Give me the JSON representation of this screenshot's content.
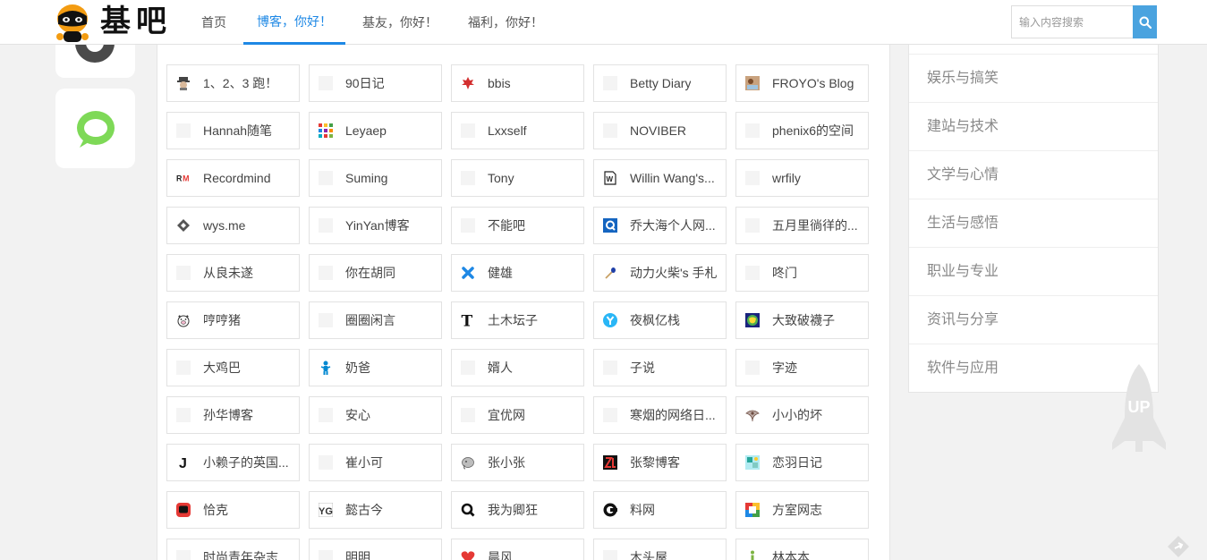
{
  "header": {
    "logo_text": "基吧",
    "nav": [
      {
        "label": "首页",
        "active": false
      },
      {
        "label": "博客，你好！",
        "active": true
      },
      {
        "label": "基友，你好！",
        "active": false
      },
      {
        "label": "福利，你好！",
        "active": false
      }
    ],
    "search": {
      "placeholder": "输入内容搜索",
      "icon": "search-icon"
    }
  },
  "colors": {
    "accent": "#1e88e5",
    "search_button": "#4aa3df",
    "chat_icon": "#7ed957"
  },
  "links": [
    {
      "label": "1、2、3 跑！",
      "icon": "avatar"
    },
    {
      "label": "90日记",
      "icon": "blank"
    },
    {
      "label": "bbis",
      "icon": "maple-leaf"
    },
    {
      "label": "Betty Diary",
      "icon": "blank"
    },
    {
      "label": "FROYO's Blog",
      "icon": "photo"
    },
    {
      "label": "Hannah随笔",
      "icon": "blank"
    },
    {
      "label": "Leyaep",
      "icon": "dots"
    },
    {
      "label": "Lxxself",
      "icon": "blank"
    },
    {
      "label": "NOVIBER",
      "icon": "blank"
    },
    {
      "label": "phenix6的空间",
      "icon": "blank"
    },
    {
      "label": "Recordmind",
      "icon": "rm-logo"
    },
    {
      "label": "Suming",
      "icon": "blank"
    },
    {
      "label": "Tony",
      "icon": "blank"
    },
    {
      "label": "Willin Wang's...",
      "icon": "w-doc"
    },
    {
      "label": "wrfily",
      "icon": "blank"
    },
    {
      "label": "wys.me",
      "icon": "diamond"
    },
    {
      "label": "YinYan博客",
      "icon": "blank"
    },
    {
      "label": "不能吧",
      "icon": "blank"
    },
    {
      "label": "乔大海个人网...",
      "icon": "q-blue"
    },
    {
      "label": "五月里徜徉的...",
      "icon": "blank"
    },
    {
      "label": "从良未遂",
      "icon": "blank"
    },
    {
      "label": "你在胡同",
      "icon": "blank"
    },
    {
      "label": "健雄",
      "icon": "x-blue"
    },
    {
      "label": "动力火柴's 手札",
      "icon": "match"
    },
    {
      "label": "咚门",
      "icon": "blank"
    },
    {
      "label": "哼哼猪",
      "icon": "pig"
    },
    {
      "label": "圈圈闲言",
      "icon": "blank"
    },
    {
      "label": "土木坛子",
      "icon": "t-serif"
    },
    {
      "label": "夜枫亿栈",
      "icon": "y-circle"
    },
    {
      "label": "大致破襪子",
      "icon": "globe"
    },
    {
      "label": "大鸡巴",
      "icon": "blank"
    },
    {
      "label": "奶爸",
      "icon": "person"
    },
    {
      "label": "婿人",
      "icon": "blank"
    },
    {
      "label": "子说",
      "icon": "blank"
    },
    {
      "label": "字迹",
      "icon": "blank"
    },
    {
      "label": "孙华博客",
      "icon": "blank"
    },
    {
      "label": "安心",
      "icon": "blank"
    },
    {
      "label": "宜优网",
      "icon": "blank"
    },
    {
      "label": "寒烟的网络日...",
      "icon": "blank"
    },
    {
      "label": "小小的坏",
      "icon": "shell"
    },
    {
      "label": "小赖子的英国...",
      "icon": "j-letter"
    },
    {
      "label": "崔小可",
      "icon": "blank"
    },
    {
      "label": "张小张",
      "icon": "elephant"
    },
    {
      "label": "张黎博客",
      "icon": "zl-red"
    },
    {
      "label": "恋羽日记",
      "icon": "puzzle"
    },
    {
      "label": "恰克",
      "icon": "red-bubble"
    },
    {
      "label": "懿古今",
      "icon": "yg-logo"
    },
    {
      "label": "我为卿狂",
      "icon": "q-black"
    },
    {
      "label": "料网",
      "icon": "c-circle"
    },
    {
      "label": "方室网志",
      "icon": "colorful"
    },
    {
      "label": "时尚青年杂志",
      "icon": "blank"
    },
    {
      "label": "明明",
      "icon": "blank"
    },
    {
      "label": "晨风",
      "icon": "heart"
    },
    {
      "label": "木头屋",
      "icon": "blank"
    },
    {
      "label": "林本本",
      "icon": "green-i"
    }
  ],
  "sidebar": {
    "categories": [
      "娱乐与搞笑",
      "建站与技术",
      "文学与心情",
      "生活与感悟",
      "职业与专业",
      "资讯与分享",
      "软件与应用"
    ]
  },
  "back_to_top": {
    "label": "UP"
  }
}
